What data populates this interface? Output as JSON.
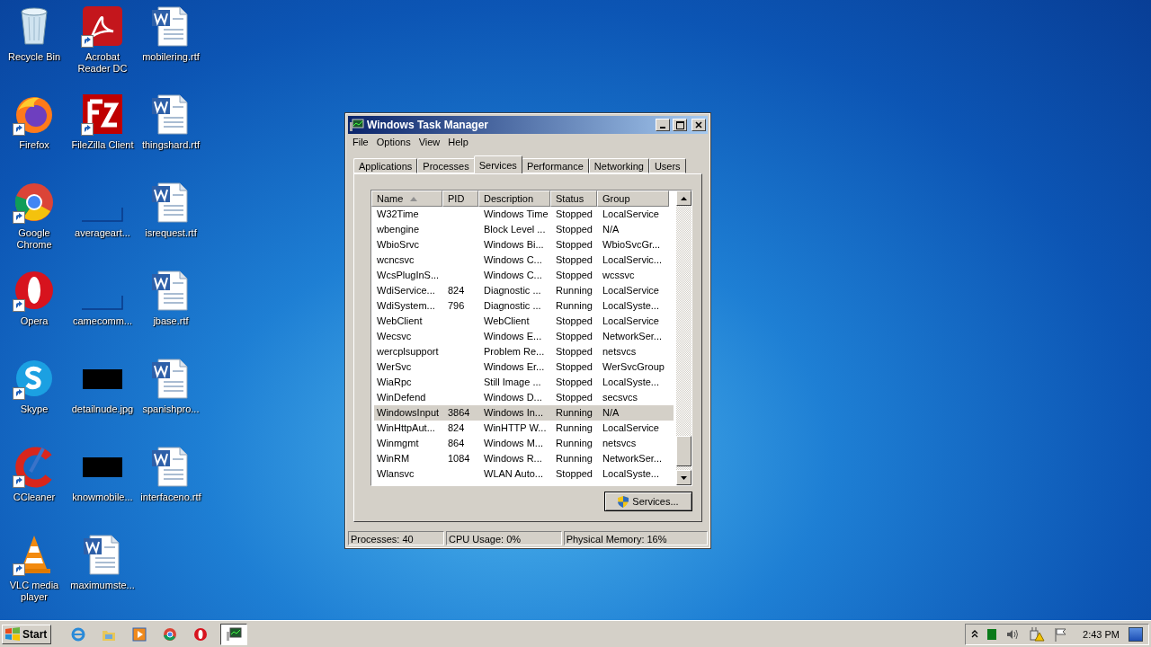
{
  "desktop_icons": [
    {
      "label": "Recycle Bin",
      "kind": "recycle",
      "shortcut": false
    },
    {
      "label": "Firefox",
      "kind": "firefox",
      "shortcut": true
    },
    {
      "label": "Google Chrome",
      "kind": "chrome",
      "shortcut": true
    },
    {
      "label": "Opera",
      "kind": "opera",
      "shortcut": true
    },
    {
      "label": "Skype",
      "kind": "skype",
      "shortcut": true
    },
    {
      "label": "CCleaner",
      "kind": "ccleaner",
      "shortcut": true
    },
    {
      "label": "VLC media player",
      "kind": "vlc",
      "shortcut": true
    },
    {
      "label": "Acrobat Reader DC",
      "kind": "acrobat",
      "shortcut": true
    },
    {
      "label": "FileZilla Client",
      "kind": "filezilla",
      "shortcut": true
    },
    {
      "label": "averageart...",
      "kind": "blank",
      "shortcut": false
    },
    {
      "label": "camecomm...",
      "kind": "blank",
      "shortcut": false
    },
    {
      "label": "detailnude.jpg",
      "kind": "black",
      "shortcut": false
    },
    {
      "label": "knowmobile...",
      "kind": "black",
      "shortcut": false
    },
    {
      "label": "maximumste...",
      "kind": "word",
      "shortcut": false
    },
    {
      "label": "mobilering.rtf",
      "kind": "word",
      "shortcut": false
    },
    {
      "label": "thingshard.rtf",
      "kind": "word",
      "shortcut": false
    },
    {
      "label": "isrequest.rtf",
      "kind": "word",
      "shortcut": false
    },
    {
      "label": "jbase.rtf",
      "kind": "word",
      "shortcut": false
    },
    {
      "label": "spanishpro...",
      "kind": "word",
      "shortcut": false
    },
    {
      "label": "interfaceno.rtf",
      "kind": "word",
      "shortcut": false
    }
  ],
  "window": {
    "title": "Windows Task Manager",
    "menu": [
      "File",
      "Options",
      "View",
      "Help"
    ],
    "tabs": [
      {
        "label": "Applications",
        "selected": false
      },
      {
        "label": "Processes",
        "selected": false
      },
      {
        "label": "Services",
        "selected": true
      },
      {
        "label": "Performance",
        "selected": false
      },
      {
        "label": "Networking",
        "selected": false
      },
      {
        "label": "Users",
        "selected": false
      }
    ],
    "table": {
      "columns": [
        {
          "label": "Name",
          "sorted": true
        },
        {
          "label": "PID",
          "sorted": false
        },
        {
          "label": "Description",
          "sorted": false
        },
        {
          "label": "Status",
          "sorted": false
        },
        {
          "label": "Group",
          "sorted": false
        }
      ],
      "rows": [
        {
          "cells": [
            "W32Time",
            "",
            "Windows Time",
            "Stopped",
            "LocalService"
          ],
          "selected": false
        },
        {
          "cells": [
            "wbengine",
            "",
            "Block Level ...",
            "Stopped",
            "N/A"
          ],
          "selected": false
        },
        {
          "cells": [
            "WbioSrvc",
            "",
            "Windows Bi...",
            "Stopped",
            "WbioSvcGr..."
          ],
          "selected": false
        },
        {
          "cells": [
            "wcncsvc",
            "",
            "Windows C...",
            "Stopped",
            "LocalServic..."
          ],
          "selected": false
        },
        {
          "cells": [
            "WcsPlugInS...",
            "",
            "Windows C...",
            "Stopped",
            "wcssvc"
          ],
          "selected": false
        },
        {
          "cells": [
            "WdiService...",
            "824",
            "Diagnostic ...",
            "Running",
            "LocalService"
          ],
          "selected": false
        },
        {
          "cells": [
            "WdiSystem...",
            "796",
            "Diagnostic ...",
            "Running",
            "LocalSyste..."
          ],
          "selected": false
        },
        {
          "cells": [
            "WebClient",
            "",
            "WebClient",
            "Stopped",
            "LocalService"
          ],
          "selected": false
        },
        {
          "cells": [
            "Wecsvc",
            "",
            "Windows E...",
            "Stopped",
            "NetworkSer..."
          ],
          "selected": false
        },
        {
          "cells": [
            "wercplsupport",
            "",
            "Problem Re...",
            "Stopped",
            "netsvcs"
          ],
          "selected": false
        },
        {
          "cells": [
            "WerSvc",
            "",
            "Windows Er...",
            "Stopped",
            "WerSvcGroup"
          ],
          "selected": false
        },
        {
          "cells": [
            "WiaRpc",
            "",
            "Still Image ...",
            "Stopped",
            "LocalSyste..."
          ],
          "selected": false
        },
        {
          "cells": [
            "WinDefend",
            "",
            "Windows D...",
            "Stopped",
            "secsvcs"
          ],
          "selected": false
        },
        {
          "cells": [
            "WindowsInput",
            "3864",
            "Windows In...",
            "Running",
            "N/A"
          ],
          "selected": true
        },
        {
          "cells": [
            "WinHttpAut...",
            "824",
            "WinHTTP W...",
            "Running",
            "LocalService"
          ],
          "selected": false
        },
        {
          "cells": [
            "Winmgmt",
            "864",
            "Windows M...",
            "Running",
            "netsvcs"
          ],
          "selected": false
        },
        {
          "cells": [
            "WinRM",
            "1084",
            "Windows R...",
            "Running",
            "NetworkSer..."
          ],
          "selected": false
        },
        {
          "cells": [
            "Wlansvc",
            "",
            "WLAN Auto...",
            "Stopped",
            "LocalSyste..."
          ],
          "selected": false
        }
      ]
    },
    "services_button": "Services...",
    "status_bar": [
      "Processes: 40",
      "CPU Usage: 0%",
      "Physical Memory: 16%"
    ]
  },
  "taskbar": {
    "start": "Start",
    "apps": [
      {
        "kind": "ie",
        "active": false
      },
      {
        "kind": "folder",
        "active": false
      },
      {
        "kind": "media",
        "active": false
      },
      {
        "kind": "chrome",
        "active": false
      },
      {
        "kind": "opera",
        "active": false
      },
      {
        "kind": "taskmgr",
        "active": true
      }
    ],
    "clock": "2:43 PM"
  }
}
